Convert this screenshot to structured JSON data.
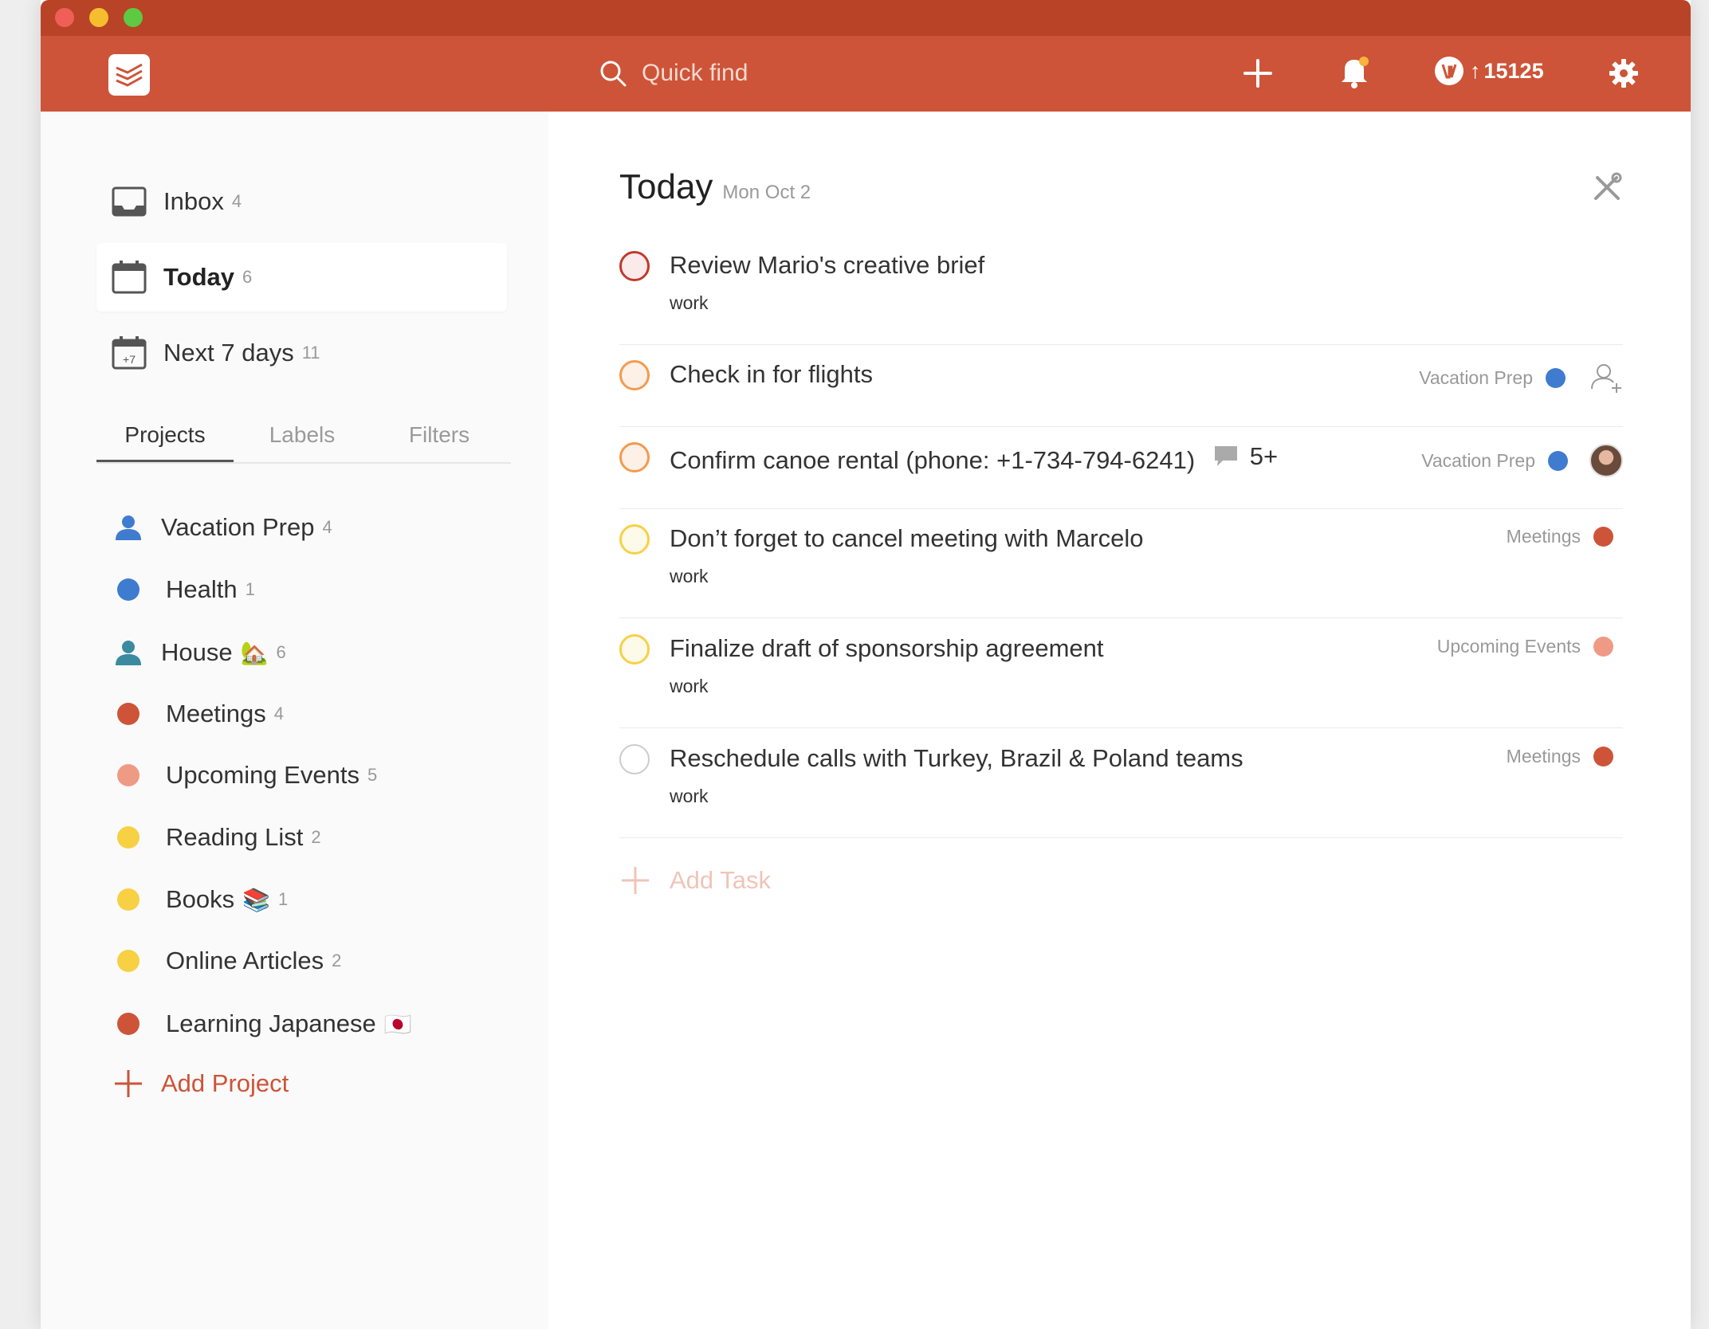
{
  "header": {
    "search_placeholder": "Quick find",
    "karma_score": "15125",
    "karma_arrow": "↑"
  },
  "sidebar": {
    "nav": [
      {
        "label": "Inbox",
        "count": "4"
      },
      {
        "label": "Today",
        "count": "6"
      },
      {
        "label": "Next 7 days",
        "count": "11",
        "icon_text": "+7"
      }
    ],
    "tabs": [
      "Projects",
      "Labels",
      "Filters"
    ],
    "projects": [
      {
        "label": "Vacation Prep",
        "count": "4",
        "icon": "person-icon",
        "color": "#3f7ccf"
      },
      {
        "label": "Health",
        "count": "1",
        "icon": "dot",
        "color": "#3f7ccf"
      },
      {
        "label": "House",
        "count": "6",
        "icon": "person-icon",
        "color": "#3a8aa0",
        "emoji": "🏡"
      },
      {
        "label": "Meetings",
        "count": "4",
        "icon": "dot",
        "color": "#cd5438"
      },
      {
        "label": "Upcoming Events",
        "count": "5",
        "icon": "dot",
        "color": "#ef9a85"
      },
      {
        "label": "Reading List",
        "count": "2",
        "icon": "dot",
        "color": "#f7d044"
      },
      {
        "label": "Books",
        "count": "1",
        "icon": "dot",
        "color": "#f7d044",
        "emoji": "📚"
      },
      {
        "label": "Online Articles",
        "count": "2",
        "icon": "dot",
        "color": "#f7d044"
      },
      {
        "label": "Learning Japanese",
        "count": "",
        "icon": "dot",
        "color": "#cd5438",
        "emoji": "🇯🇵"
      }
    ],
    "add_project": "Add Project"
  },
  "main": {
    "title": "Today",
    "date": "Mon Oct 2",
    "tasks": [
      {
        "text": "Review Mario's creative brief",
        "label": "work",
        "priority_color": "#c0392b",
        "project": "",
        "project_color": ""
      },
      {
        "text": "Check in for flights",
        "label": "",
        "priority_color": "#f39a4e",
        "project": "Vacation Prep",
        "project_color": "#3f7ccf"
      },
      {
        "text": "Confirm canoe rental (phone: +1-734-794-6241)",
        "label": "",
        "priority_color": "#f39a4e",
        "project": "Vacation Prep",
        "project_color": "#3f7ccf",
        "comments": "5+"
      },
      {
        "text": "Don’t forget to cancel meeting with Marcelo",
        "label": "work",
        "priority_color": "#f7d044",
        "project": "Meetings",
        "project_color": "#cd5438"
      },
      {
        "text": "Finalize draft of sponsorship agreement",
        "label": "work",
        "priority_color": "#f7d044",
        "project": "Upcoming Events",
        "project_color": "#ef9a85"
      },
      {
        "text": "Reschedule calls with Turkey, Brazil & Poland teams",
        "label": "work",
        "priority_color": "#cccccc",
        "project": "Meetings",
        "project_color": "#cd5438"
      }
    ],
    "add_task": "Add Task"
  },
  "colors": {
    "brand": "#cd5438",
    "titlebar": "#b84326"
  }
}
